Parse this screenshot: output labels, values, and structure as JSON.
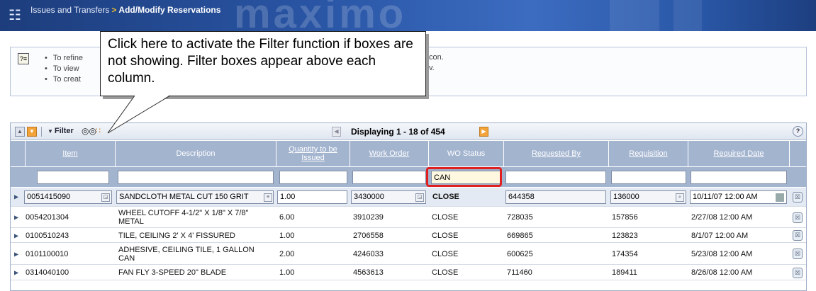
{
  "header": {
    "breadcrumb_app": "Issues and Transfers",
    "breadcrumb_sep": ">",
    "breadcrumb_page": "Add/Modify Reservations",
    "watermark": "maximo"
  },
  "instructions": {
    "items": [
      "To refine",
      "To view",
      "To creat"
    ],
    "trailing": [
      "con.",
      "v."
    ]
  },
  "callout": {
    "text": "Click here to activate the Filter function if boxes are not showing. Filter boxes appear above each column."
  },
  "toolbar": {
    "filter_label": "Filter",
    "pagination": "Displaying 1 - 18 of 454",
    "help": "?"
  },
  "columns": [
    {
      "label": "Item",
      "sortable": true
    },
    {
      "label": "Description",
      "sortable": false
    },
    {
      "label": "Quantity to be Issued",
      "sortable": true
    },
    {
      "label": "Work Order",
      "sortable": true
    },
    {
      "label": "WO Status",
      "sortable": false
    },
    {
      "label": "Requested By",
      "sortable": true
    },
    {
      "label": "Requisition",
      "sortable": true
    },
    {
      "label": "Required Date",
      "sortable": true
    }
  ],
  "filters": {
    "item": "",
    "description": "",
    "quantity": "",
    "work_order": "",
    "wo_status": "CAN",
    "requested_by": "",
    "requisition": "",
    "required_date": ""
  },
  "rows": [
    {
      "item": "0051415090",
      "description": "SANDCLOTH METAL CUT 150 GRIT",
      "quantity": "1.00",
      "work_order": "3430000",
      "wo_status": "CLOSE",
      "requested_by": "644358",
      "requisition": "136000",
      "required_date": "10/11/07 12:00 AM"
    },
    {
      "item": "0054201304",
      "description": "WHEEL CUTOFF 4-1/2\" X 1/8\" X 7/8\" METAL",
      "quantity": "6.00",
      "work_order": "3910239",
      "wo_status": "CLOSE",
      "requested_by": "728035",
      "requisition": "157856",
      "required_date": "2/27/08 12:00 AM"
    },
    {
      "item": "0100510243",
      "description": "TILE, CEILING 2' X 4' FISSURED",
      "quantity": "1.00",
      "work_order": "2706558",
      "wo_status": "CLOSE",
      "requested_by": "669865",
      "requisition": "123823",
      "required_date": "8/1/07 12:00 AM"
    },
    {
      "item": "0101100010",
      "description": "ADHESIVE, CEILING TILE, 1 GALLON CAN",
      "quantity": "2.00",
      "work_order": "4246033",
      "wo_status": "CLOSE",
      "requested_by": "600625",
      "requisition": "174354",
      "required_date": "5/23/08 12:00 AM"
    },
    {
      "item": "0314040100",
      "description": "FAN FLY 3-SPEED 20\" BLADE",
      "quantity": "1.00",
      "work_order": "4563613",
      "wo_status": "CLOSE",
      "requested_by": "711460",
      "requisition": "189411",
      "required_date": "8/26/08 12:00 AM"
    }
  ],
  "icons": {
    "app": "app-icon",
    "help": "help-icon",
    "collapse": "collapse-icon",
    "expand": "expand-icon",
    "binoculars": "binoculars-icon",
    "clear_filter": "clear-filter-icon",
    "prev": "previous-page-icon",
    "next": "next-page-icon",
    "delete": "delete-icon"
  },
  "colors": {
    "header_dark": "#1d3d7c",
    "grid_header": "#a3b4cf",
    "highlight": "#e02020",
    "accent": "#f2a43a"
  }
}
